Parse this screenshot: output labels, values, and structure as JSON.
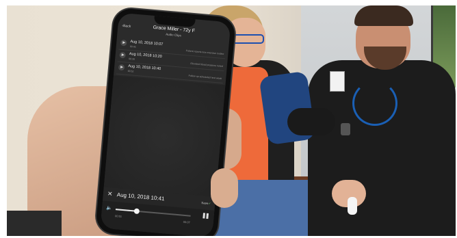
{
  "app": {
    "back_label": "Back",
    "patient_title": "Grace Miller - 72y F",
    "subtitle": "Audio Clips"
  },
  "clips": [
    {
      "date": "Aug 10, 2018 10:07",
      "duration": "00:45",
      "note": "Patient reports new exercise routine"
    },
    {
      "date": "Aug 10, 2018 10:20",
      "duration": "00:30",
      "note": "Elevated blood pressure noted"
    },
    {
      "date": "Aug 10, 2018 10:40",
      "duration": "00:52",
      "note": "Follow-up scheduled next week"
    }
  ],
  "recording": {
    "close_icon": "close-icon",
    "date": "Aug 10, 2018 10:41",
    "save_label": "Save",
    "check_icon": "check-icon"
  },
  "player": {
    "speaker_icon": "speaker-icon",
    "pause_icon": "pause-icon",
    "elapsed": "00:01",
    "total": "00:07",
    "progress": 0.28
  },
  "colors": {
    "screen_bg": "#2b2b2b",
    "accent_check": "#6bc46b"
  }
}
